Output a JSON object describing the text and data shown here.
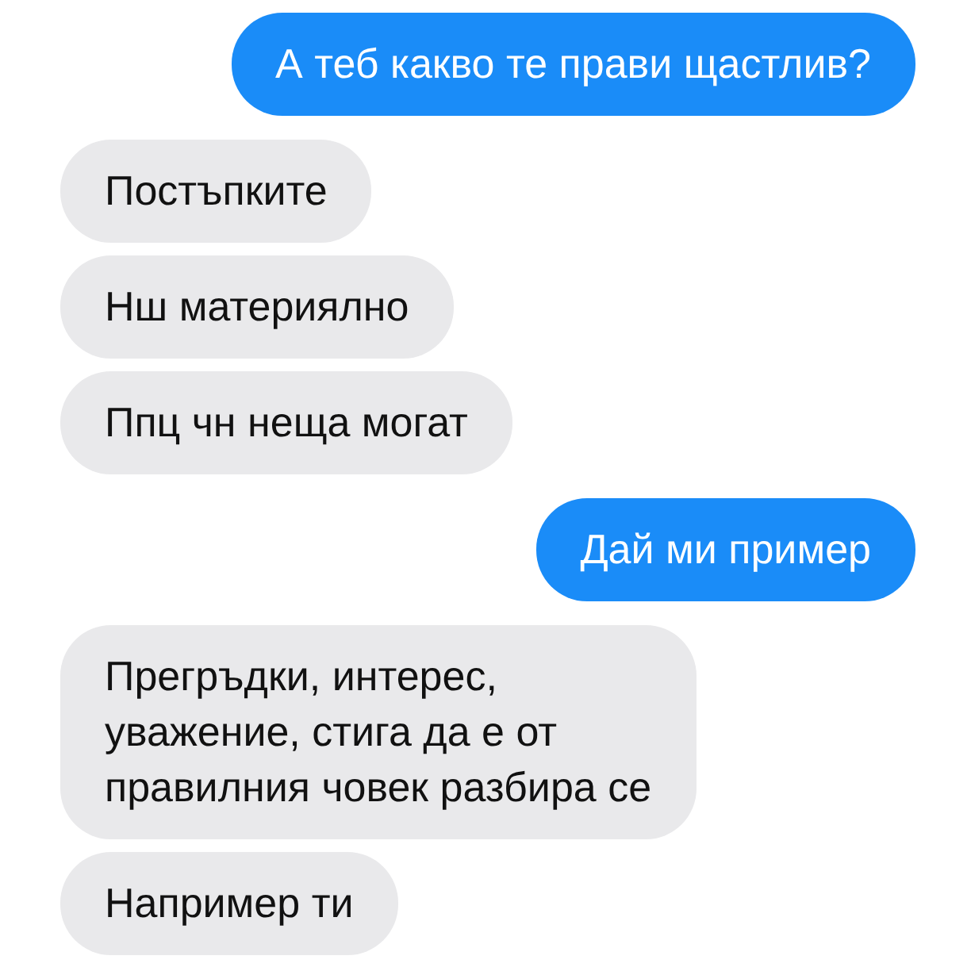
{
  "messages": [
    {
      "kind": "outgoing",
      "lines": [
        "А теб какво те прави щастлив?"
      ]
    },
    {
      "kind": "incoming",
      "lines": [
        "Постъпките"
      ]
    },
    {
      "kind": "incoming",
      "lines": [
        "Нш материялно"
      ]
    },
    {
      "kind": "incoming",
      "lines": [
        "Ппц чн неща могат"
      ]
    },
    {
      "kind": "outgoing",
      "lines": [
        "Дай ми пример"
      ]
    },
    {
      "kind": "incoming",
      "lines": [
        "Прегръдки, интерес,",
        "уважение, стига да е от",
        "правилния човек разбира се"
      ]
    },
    {
      "kind": "incoming",
      "lines": [
        "Например ти"
      ]
    }
  ]
}
